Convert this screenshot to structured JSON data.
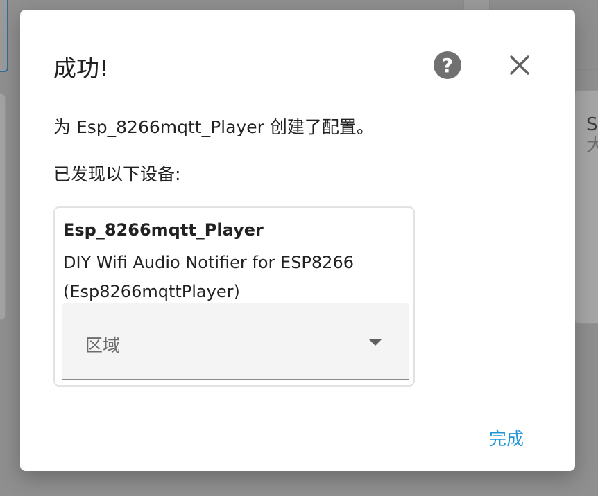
{
  "background": {
    "right_text_line1": "S",
    "right_text_line2": "大"
  },
  "dialog": {
    "title": "成功!",
    "description": "为 Esp_8266mqtt_Player 创建了配置。",
    "found_devices_label": "已发现以下设备:",
    "device": {
      "name": "Esp_8266mqtt_Player",
      "model_line1": "DIY Wifi Audio Notifier for ESP8266",
      "model_line2": "(Esp8266mqttPlayer)",
      "area_label": "区域"
    },
    "done_label": "完成"
  },
  "icons": {
    "help": "help-icon",
    "close": "close-icon",
    "dropdown": "dropdown-arrow-icon"
  },
  "colors": {
    "accent": "#2196d6",
    "help_icon": "#707070",
    "overlay": "#8f8f8f"
  }
}
